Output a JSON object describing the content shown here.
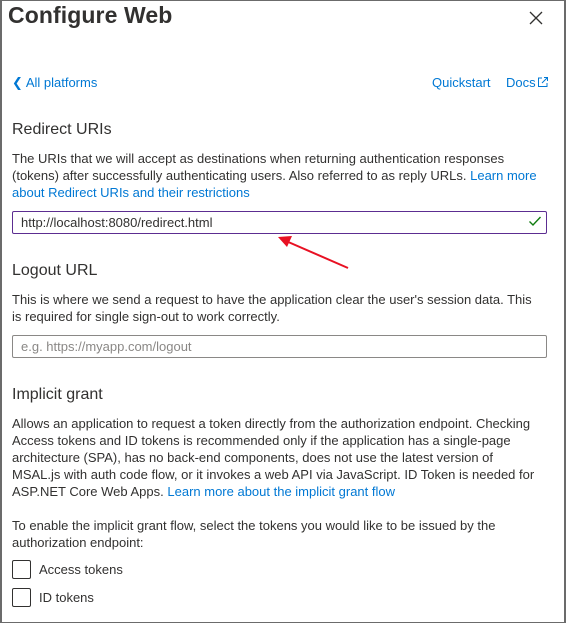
{
  "panel": {
    "title": "Configure Web"
  },
  "nav": {
    "back_label": "All platforms",
    "quickstart_label": "Quickstart",
    "docs_label": "Docs"
  },
  "redirect": {
    "heading": "Redirect URIs",
    "description": "The URIs that we will accept as destinations when returning authentication responses (tokens) after successfully authenticating users. Also referred to as reply URLs.",
    "link": "Learn more about Redirect URIs and their restrictions",
    "value": "http://localhost:8080/redirect.html"
  },
  "logout": {
    "heading": "Logout URL",
    "description": "This is where we send a request to have the application clear the user's session data. This is required for single sign-out to work correctly.",
    "placeholder": "e.g. https://myapp.com/logout",
    "value": ""
  },
  "implicit": {
    "heading": "Implicit grant",
    "description": "Allows an application to request a token directly from the authorization endpoint. Checking Access tokens and ID tokens is recommended only if the application has a single-page architecture (SPA), has no back-end components, does not use the latest version of MSAL.js with auth code flow, or it invokes a web API via JavaScript. ID Token is needed for ASP.NET Core Web Apps.",
    "link": "Learn more about the implicit grant flow",
    "instruction": "To enable the implicit grant flow, select the tokens you would like to be issued by the authorization endpoint:",
    "options": [
      {
        "label": "Access tokens",
        "checked": false
      },
      {
        "label": "ID tokens",
        "checked": false
      }
    ]
  },
  "colors": {
    "link": "#0078d4",
    "active_border": "#5c2d91",
    "valid_check": "#107c10",
    "annotation_arrow": "#e81123"
  },
  "icons": [
    "close-icon",
    "chevron-left-icon",
    "external-link-icon",
    "checkmark-icon",
    "annotation-arrow"
  ]
}
